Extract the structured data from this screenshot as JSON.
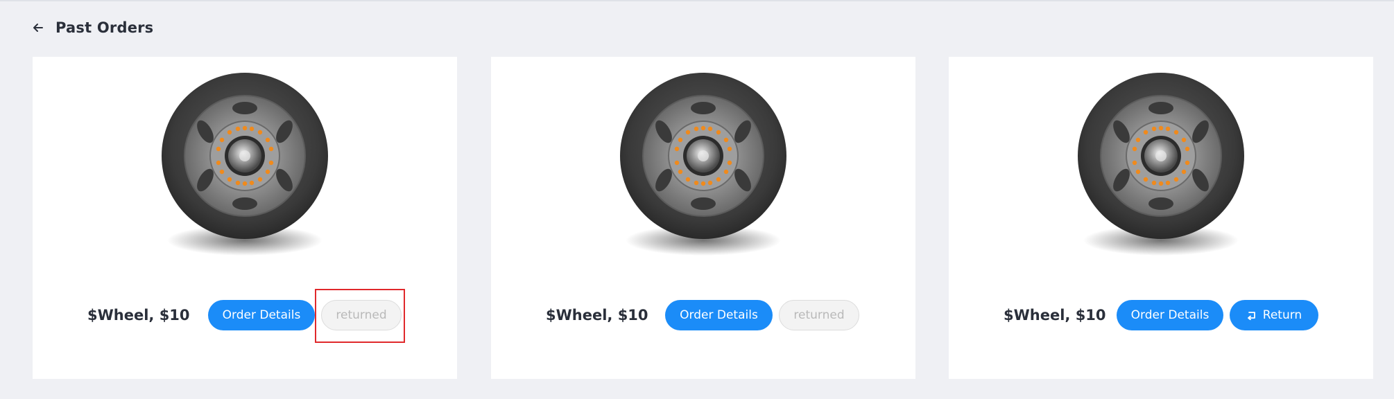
{
  "page": {
    "title": "Past Orders"
  },
  "icons": {
    "back": "arrow-left-icon",
    "return": "return-arrow-icon",
    "product": "wheel-image"
  },
  "colors": {
    "background": "#eff0f4",
    "card": "#ffffff",
    "primary": "#1b8cf8",
    "disabled_text": "#b9b9b9",
    "highlight": "#e0282b",
    "wheel_bolts": "#f08a1c"
  },
  "orders": [
    {
      "product": "$Wheel, $10",
      "details_label": "Order Details",
      "status_label": "returned",
      "status_state": "disabled",
      "highlighted": true
    },
    {
      "product": "$Wheel, $10",
      "details_label": "Order Details",
      "status_label": "returned",
      "status_state": "disabled",
      "highlighted": false
    },
    {
      "product": "$Wheel, $10",
      "details_label": "Order Details",
      "return_label": "Return",
      "status_state": "active",
      "highlighted": false
    }
  ]
}
